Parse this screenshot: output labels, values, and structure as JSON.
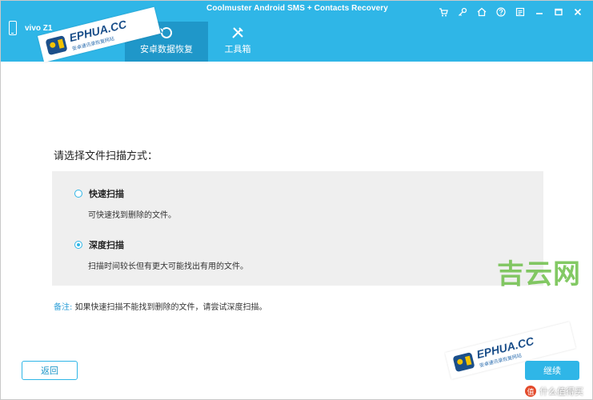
{
  "window": {
    "title": "Coolmuster Android SMS + Contacts Recovery",
    "controls": [
      "cart-icon",
      "key-icon",
      "home-icon",
      "help-icon",
      "feedback-icon",
      "minimize-icon",
      "maximize-icon",
      "close-icon"
    ]
  },
  "device": {
    "name": "vivo Z1",
    "icon": "phone-icon"
  },
  "tabs": [
    {
      "label": "安卓数据恢复",
      "icon": "recovery-icon",
      "active": true
    },
    {
      "label": "工具箱",
      "icon": "tools-icon",
      "active": false
    }
  ],
  "scan": {
    "prompt": "请选择文件扫描方式：",
    "options": [
      {
        "title": "快速扫描",
        "description": "可快速找到删除的文件。",
        "selected": false
      },
      {
        "title": "深度扫描",
        "description": "扫描时间较长但有更大可能找出有用的文件。",
        "selected": true
      }
    ],
    "note_label": "备注:",
    "note_text": "如果快速扫描不能找到删除的文件，请尝试深度扫描。"
  },
  "buttons": {
    "back": "返回",
    "next": "继续"
  },
  "watermarks": {
    "stamp_brand": "EPHUA.CC",
    "stamp_sub": "安卓通讯录恢复网站",
    "site": "吉云网",
    "smzdm_badge": "值",
    "smzdm_text": "什么值得买"
  },
  "colors": {
    "accent": "#2fb6e7",
    "tab_active": "#1f97c9",
    "panel_bg": "#efefef"
  }
}
